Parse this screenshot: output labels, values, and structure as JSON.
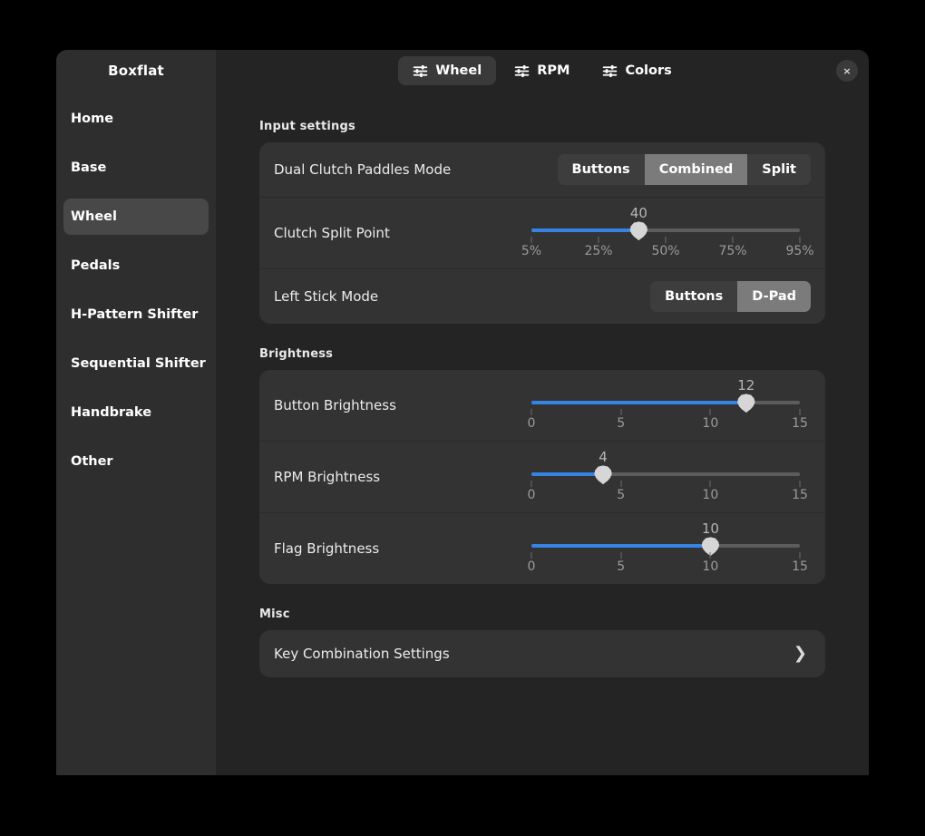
{
  "window": {
    "close_label": "×"
  },
  "sidebar": {
    "title": "Boxflat",
    "items": [
      {
        "label": "Home",
        "selected": false
      },
      {
        "label": "Base",
        "selected": false
      },
      {
        "label": "Wheel",
        "selected": true
      },
      {
        "label": "Pedals",
        "selected": false
      },
      {
        "label": "H-Pattern Shifter",
        "selected": false
      },
      {
        "label": "Sequential Shifter",
        "selected": false
      },
      {
        "label": "Handbrake",
        "selected": false
      },
      {
        "label": "Other",
        "selected": false
      }
    ]
  },
  "tabs": [
    {
      "label": "Wheel",
      "icon": "sliders-icon",
      "active": true
    },
    {
      "label": "RPM",
      "icon": "sliders-icon",
      "active": false
    },
    {
      "label": "Colors",
      "icon": "sliders-icon",
      "active": false
    }
  ],
  "sections": {
    "input": {
      "title": "Input settings",
      "dual_clutch": {
        "label": "Dual Clutch Paddles Mode",
        "options": [
          "Buttons",
          "Combined",
          "Split"
        ],
        "selected": "Combined"
      },
      "clutch_split": {
        "label": "Clutch Split Point",
        "value": "40",
        "value_number": 40,
        "min": 0,
        "max": 100,
        "fill_percent": 40,
        "ticks": [
          "5%",
          "25%",
          "50%",
          "75%",
          "95%"
        ],
        "tick_positions": [
          0,
          25,
          50,
          75,
          100
        ]
      },
      "left_stick": {
        "label": "Left Stick Mode",
        "options": [
          "Buttons",
          "D-Pad"
        ],
        "selected": "D-Pad"
      }
    },
    "brightness": {
      "title": "Brightness",
      "sliders": [
        {
          "label": "Button Brightness",
          "value": "12",
          "value_number": 12,
          "min": 0,
          "max": 15,
          "fill_percent": 80,
          "ticks": [
            "0",
            "5",
            "10",
            "15"
          ],
          "tick_positions": [
            0,
            33.33,
            66.67,
            100
          ]
        },
        {
          "label": "RPM Brightness",
          "value": "4",
          "value_number": 4,
          "min": 0,
          "max": 15,
          "fill_percent": 26.7,
          "ticks": [
            "0",
            "5",
            "10",
            "15"
          ],
          "tick_positions": [
            0,
            33.33,
            66.67,
            100
          ]
        },
        {
          "label": "Flag Brightness",
          "value": "10",
          "value_number": 10,
          "min": 0,
          "max": 15,
          "fill_percent": 66.7,
          "ticks": [
            "0",
            "5",
            "10",
            "15"
          ],
          "tick_positions": [
            0,
            33.33,
            66.67,
            100
          ]
        }
      ]
    },
    "misc": {
      "title": "Misc",
      "key_combination": {
        "label": "Key Combination Settings",
        "chevron": "❯"
      }
    }
  },
  "colors": {
    "accent": "#3584e4",
    "window_bg": "#242424",
    "sidebar_bg": "#2e2e2e",
    "card_bg": "#333333",
    "selected_segment": "#7b7b7b",
    "thumb": "#d6d6d6"
  }
}
